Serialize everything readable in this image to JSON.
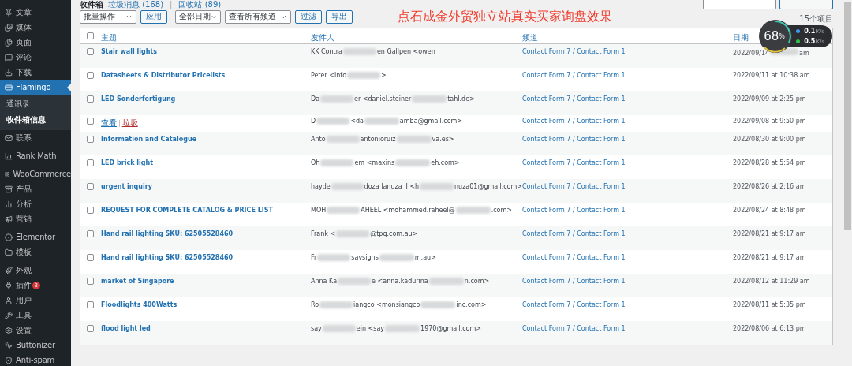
{
  "sidebar": {
    "items": [
      {
        "label": "文章",
        "selected": false
      },
      {
        "label": "媒体",
        "selected": false
      },
      {
        "label": "页面",
        "selected": false
      },
      {
        "label": "评论",
        "selected": false
      },
      {
        "label": "下载",
        "selected": false
      },
      {
        "label": "Flamingo",
        "selected": true,
        "children": [
          {
            "label": "通讯录",
            "selected": false
          },
          {
            "label": "收件箱信息",
            "selected": true
          }
        ]
      },
      {
        "label": "联系",
        "selected": false
      },
      {
        "label": "Rank Math",
        "selected": false
      },
      {
        "label": "WooCommerce",
        "selected": false
      },
      {
        "label": "产品",
        "selected": false
      },
      {
        "label": "分析",
        "selected": false
      },
      {
        "label": "营销",
        "selected": false
      },
      {
        "label": "Elementor",
        "selected": false
      },
      {
        "label": "模板",
        "selected": false
      },
      {
        "label": "外观",
        "selected": false
      },
      {
        "label": "插件",
        "selected": false,
        "badge": "3"
      },
      {
        "label": "用户",
        "selected": false
      },
      {
        "label": "工具",
        "selected": false
      },
      {
        "label": "设置",
        "selected": false
      },
      {
        "label": "Buttonizer",
        "selected": false
      },
      {
        "label": "Anti-spam",
        "selected": false
      }
    ]
  },
  "view_separator": "|",
  "action_separator": "|",
  "views": [
    {
      "label": "收件箱",
      "selected": true
    },
    {
      "label": "垃圾消息 (168)",
      "selected": false
    },
    {
      "label": "回收站 (89)",
      "selected": false
    }
  ],
  "filters": {
    "bulk_action": "批量操作",
    "apply": "应用",
    "date": "全部日期",
    "channel": "查看所有频道",
    "filter": "过滤",
    "export": "导出"
  },
  "annotation": "点石成金外贸独立站真实买家询盘效果",
  "item_count": "15个项目",
  "speed_widget": {
    "percent": "68",
    "unit": "%",
    "upload": "0.1",
    "upload_unit": "K/s",
    "download": "0.5",
    "download_unit": "K/s"
  },
  "table": {
    "select_all_checked": false,
    "channel_separator": "/",
    "columns": [
      "主题",
      "发件人",
      "频道",
      "日期"
    ],
    "rows": [
      {
        "subject": "Stair wall lights",
        "sender": [
          "KK Contra",
          "en Gallpen <owen"
        ],
        "channel": [
          "Contact Form 7",
          "Contact Form 1"
        ],
        "date": "2022/09/14",
        "date_tail": "am",
        "checked": false
      },
      {
        "subject": "Datasheets & Distributor Pricelists",
        "sender": [
          "Peter <info",
          ">"
        ],
        "channel": [
          "Contact Form 7",
          "Contact Form 1"
        ],
        "date": "2022/09/11 at 10:38 am",
        "checked": false
      },
      {
        "subject": "LED Sonderfertigung",
        "sender": [
          "Da",
          "er <daniel.steiner",
          "tahl.de>"
        ],
        "channel": [
          "Contact Form 7",
          "Contact Form 1"
        ],
        "date": "2022/09/09 at 2:25 pm",
        "checked": false
      },
      {
        "actions": [
          {
            "label": "查看",
            "kind": "view"
          },
          {
            "label": "垃圾",
            "kind": "spam"
          }
        ],
        "sender": [
          "D",
          "<da",
          "amba@gmail.com>"
        ],
        "channel": [
          "Contact Form 7",
          "Contact Form 1"
        ],
        "date": "2022/09/08 at 9:50 pm",
        "checked": false
      },
      {
        "subject": "Information and Catalogue",
        "sender": [
          "Anto",
          "antonioruiz",
          "va.es>"
        ],
        "channel": [
          "Contact Form 7",
          "Contact Form 1"
        ],
        "date": "2022/08/30 at 9:00 pm",
        "checked": false
      },
      {
        "subject": "LED brick light",
        "sender": [
          "Oh",
          "em <maxins",
          "eh.com>"
        ],
        "channel": [
          "Contact Form 7",
          "Contact Form 1"
        ],
        "date": "2022/08/28 at 5:54 pm",
        "checked": false
      },
      {
        "subject": "urgent inquiry",
        "sender": [
          "hayde",
          "doza lanuza II <h",
          "nuza01@gmail.com>"
        ],
        "channel": [
          "Contact Form 7",
          "Contact Form 1"
        ],
        "date": "2022/08/26 at 2:16 am",
        "checked": false
      },
      {
        "subject": "REQUEST FOR COMPLETE CATALOG & PRICE LIST",
        "sender": [
          "MOH",
          "AHEEL <mohammed.raheel@",
          ".com>"
        ],
        "channel": [
          "Contact Form 7",
          "Contact Form 1"
        ],
        "date": "2022/08/24 at 8:48 pm",
        "checked": false
      },
      {
        "subject": "Hand rail lighting SKU: 62505528460",
        "sender": [
          "Frank <",
          "@tpg.com.au>"
        ],
        "channel": [
          "Contact Form 7",
          "Contact Form 1"
        ],
        "date": "2022/08/21 at 9:17 am",
        "checked": false
      },
      {
        "subject": "Hand rail lighting SKU: 62505528460",
        "sender": [
          "Fr",
          "savsigns",
          "m.au>"
        ],
        "channel": [
          "Contact Form 7",
          "Contact Form 1"
        ],
        "date": "2022/08/21 at 9:17 am",
        "checked": false
      },
      {
        "subject": "market of Singapore",
        "sender": [
          "Anna Ka",
          "e <anna.kadurina",
          "n.com>"
        ],
        "channel": [
          "Contact Form 7",
          "Contact Form 1"
        ],
        "date": "2022/08/12 at 11:29 am",
        "checked": false
      },
      {
        "subject": "Floodlights 400Watts",
        "sender": [
          "Ro",
          "iangco <monsiangco",
          "inc.com>"
        ],
        "channel": [
          "Contact Form 7",
          "Contact Form 1"
        ],
        "date": "2022/08/11 at 5:35 pm",
        "checked": false
      },
      {
        "subject": "flood light led",
        "sender": [
          "say",
          "ein <say",
          "1970@gmail.com>"
        ],
        "channel": [
          "Contact Form 7",
          "Contact Form 1"
        ],
        "date": "2022/08/06 at 6:13 pm",
        "checked": false
      }
    ]
  }
}
